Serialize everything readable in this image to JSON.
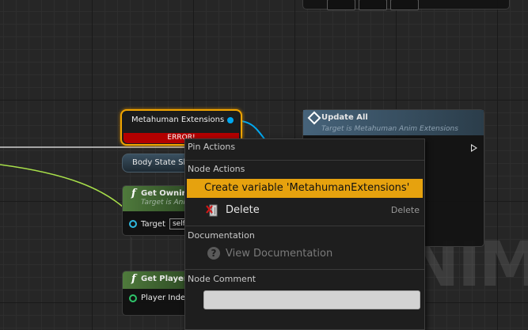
{
  "watermark": "NIMA",
  "nodes": {
    "variable": {
      "label": "Metahuman Extensions",
      "error": "ERROR!"
    },
    "body_state": {
      "label": "Body State Ske"
    },
    "get_owning": {
      "title": "Get Owning",
      "subtitle": "Target is Ani",
      "target_label": "Target",
      "target_value": "self"
    },
    "get_player": {
      "title": "Get Player",
      "pin_label": "Player Index"
    },
    "update_all": {
      "title": "Update All",
      "subtitle": "Target is Metahuman Anim Extensions"
    }
  },
  "context_menu": {
    "pin_actions": "Pin Actions",
    "node_actions": "Node Actions",
    "create_variable": "Create variable 'MetahumanExtensions'",
    "delete": "Delete",
    "delete_shortcut": "Delete",
    "documentation": "Documentation",
    "view_documentation": "View Documentation",
    "node_comment": "Node Comment",
    "comment_value": ""
  },
  "colors": {
    "highlight": "#e6a20e",
    "error": "#b30000",
    "object_pin": "#00a8f0",
    "exec_wire": "#a8e04a"
  }
}
